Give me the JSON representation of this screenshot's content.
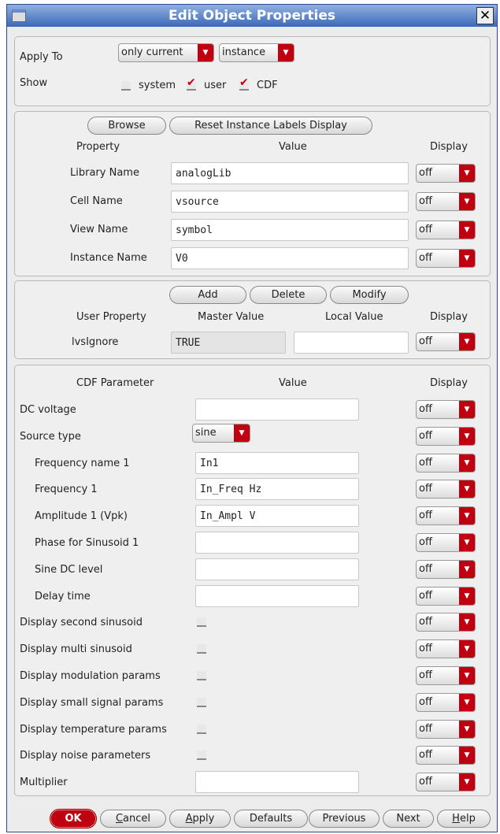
{
  "title": "Edit Object Properties",
  "apply_to": {
    "label": "Apply To",
    "scope": "only current",
    "target": "instance"
  },
  "show": {
    "label": "Show",
    "options": [
      {
        "label": "system",
        "checked": false
      },
      {
        "label": "user",
        "checked": true
      },
      {
        "label": "CDF",
        "checked": true
      }
    ]
  },
  "props": {
    "browse": "Browse",
    "reset": "Reset Instance Labels Display",
    "headers": [
      "Property",
      "Value",
      "Display"
    ],
    "rows": [
      {
        "label": "Library Name",
        "value": "analogLib",
        "display": "off"
      },
      {
        "label": "Cell Name",
        "value": "vsource",
        "display": "off"
      },
      {
        "label": "View Name",
        "value": "symbol",
        "display": "off"
      },
      {
        "label": "Instance Name",
        "value": "V0",
        "display": "off"
      }
    ]
  },
  "user": {
    "add": "Add",
    "delete": "Delete",
    "modify": "Modify",
    "headers": [
      "User Property",
      "Master Value",
      "Local Value",
      "Display"
    ],
    "rows": [
      {
        "label": "lvsIgnore",
        "master": "TRUE",
        "local": "",
        "display": "off"
      }
    ]
  },
  "cdf": {
    "headers": [
      "CDF Parameter",
      "Value",
      "Display"
    ],
    "rows": [
      {
        "label": "DC voltage",
        "type": "text",
        "value": "",
        "display": "off",
        "indent": false
      },
      {
        "label": "Source type",
        "type": "select",
        "value": "sine",
        "display": "off",
        "indent": false
      },
      {
        "label": "Frequency name 1",
        "type": "text",
        "value": "In1",
        "display": "off",
        "indent": true
      },
      {
        "label": "Frequency 1",
        "type": "text",
        "value": "In_Freq Hz",
        "display": "off",
        "indent": true
      },
      {
        "label": "Amplitude 1 (Vpk)",
        "type": "text",
        "value": "In_Ampl V",
        "display": "off",
        "indent": true
      },
      {
        "label": "Phase for Sinusoid 1",
        "type": "text",
        "value": "",
        "display": "off",
        "indent": true
      },
      {
        "label": "Sine DC level",
        "type": "text",
        "value": "",
        "display": "off",
        "indent": true
      },
      {
        "label": "Delay time",
        "type": "text",
        "value": "",
        "display": "off",
        "indent": true
      },
      {
        "label": "Display second sinusoid",
        "type": "check",
        "display": "off",
        "indent": false
      },
      {
        "label": "Display multi sinusoid",
        "type": "check",
        "display": "off",
        "indent": false
      },
      {
        "label": "Display modulation params",
        "type": "check",
        "display": "off",
        "indent": false
      },
      {
        "label": "Display small signal params",
        "type": "check",
        "display": "off",
        "indent": false
      },
      {
        "label": "Display temperature params",
        "type": "check",
        "display": "off",
        "indent": false
      },
      {
        "label": "Display noise parameters",
        "type": "check",
        "display": "off",
        "indent": false
      },
      {
        "label": "Multiplier",
        "type": "text",
        "value": "",
        "display": "off",
        "indent": false
      }
    ]
  },
  "buttons": [
    {
      "label": "OK",
      "u": ""
    },
    {
      "label": "ancel",
      "u": "C"
    },
    {
      "label": "pply",
      "u": "A"
    },
    {
      "label": "Defaults",
      "u": ""
    },
    {
      "label": "Previous",
      "u": ""
    },
    {
      "label": "Next",
      "u": ""
    },
    {
      "label": "elp",
      "u": "H"
    }
  ]
}
